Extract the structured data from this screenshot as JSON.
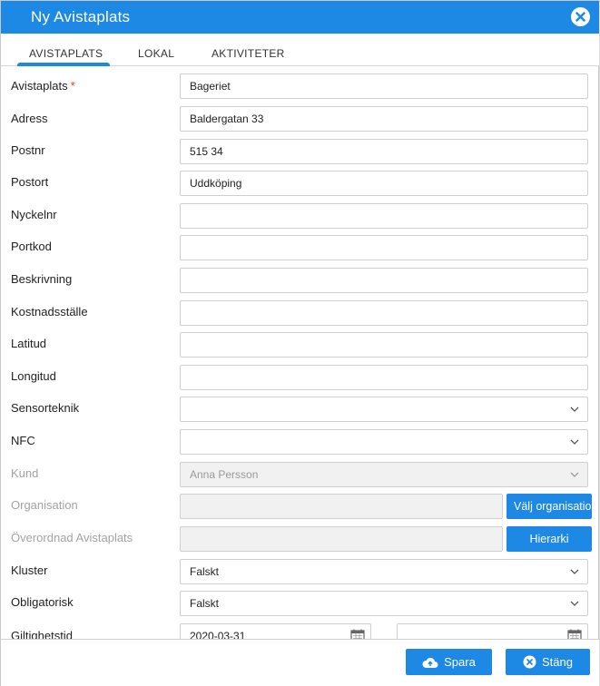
{
  "dialog": {
    "title": "Ny Avistaplats"
  },
  "tabs": [
    {
      "label": "AVISTAPLATS"
    },
    {
      "label": "LOKAL"
    },
    {
      "label": "AKTIVITETER"
    }
  ],
  "fields": {
    "avistaplats": {
      "label": "Avistaplats",
      "required_mark": "*",
      "value": "Bageriet"
    },
    "adress": {
      "label": "Adress",
      "value": "Baldergatan 33"
    },
    "postnr": {
      "label": "Postnr",
      "value": "515 34"
    },
    "postort": {
      "label": "Postort",
      "value": "Uddköping"
    },
    "nyckelnr": {
      "label": "Nyckelnr",
      "value": ""
    },
    "portkod": {
      "label": "Portkod",
      "value": ""
    },
    "beskrivning": {
      "label": "Beskrivning",
      "value": ""
    },
    "kostnadsstalle": {
      "label": "Kostnadsställe",
      "value": ""
    },
    "latitud": {
      "label": "Latitud",
      "value": ""
    },
    "longitud": {
      "label": "Longitud",
      "value": ""
    },
    "sensorteknik": {
      "label": "Sensorteknik",
      "value": ""
    },
    "nfc": {
      "label": "NFC",
      "value": ""
    },
    "kund": {
      "label": "Kund",
      "value": "Anna Persson"
    },
    "organisation": {
      "label": "Organisation",
      "value": "",
      "button": "Välj organisation"
    },
    "overordnad": {
      "label": "Överordnad Avistaplats",
      "value": "",
      "button": "Hierarki"
    },
    "kluster": {
      "label": "Kluster",
      "value": "Falskt"
    },
    "obligatorisk": {
      "label": "Obligatorisk",
      "value": "Falskt"
    },
    "giltighetstid": {
      "label": "Giltighetstid",
      "from": "2020-03-31",
      "to": ""
    }
  },
  "footer": {
    "save": "Spara",
    "close": "Stäng"
  },
  "colors": {
    "accent": "#1e88e5",
    "required": "#e53935"
  }
}
